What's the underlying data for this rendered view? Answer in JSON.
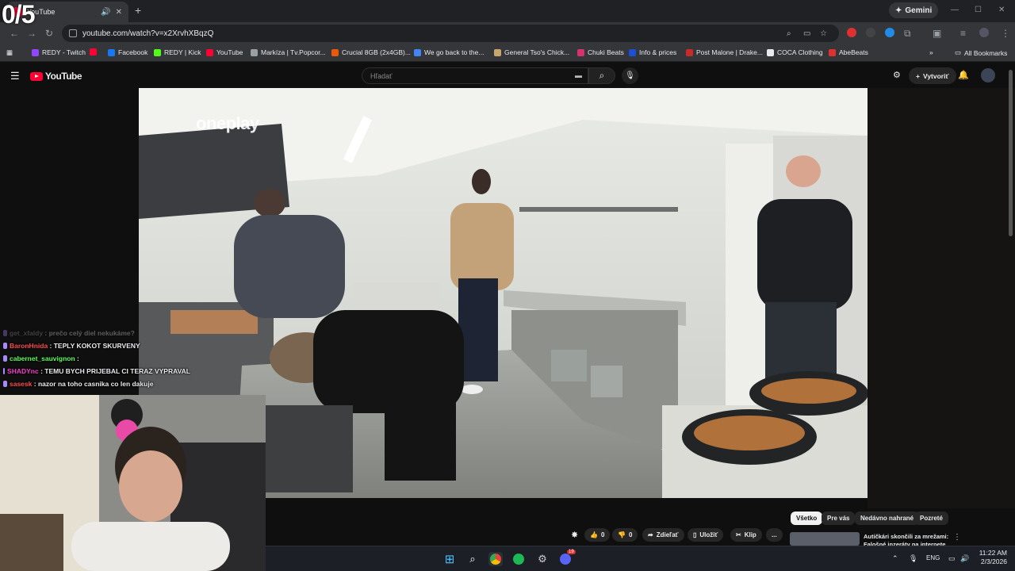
{
  "overlay_counter": "0/5",
  "browser": {
    "tab_title": "YouTube",
    "new_tab": "+",
    "gemini_label": "Gemini",
    "url": "youtube.com/watch?v=x2XrvhXBqzQ",
    "bookmarks": [
      {
        "label": "REDY - Twitch",
        "color": "#9146ff"
      },
      {
        "label": "",
        "color": "#ff0033"
      },
      {
        "label": "Facebook",
        "color": "#1877f2"
      },
      {
        "label": "REDY | Kick",
        "color": "#53fc18"
      },
      {
        "label": "YouTube",
        "color": "#ff0033"
      },
      {
        "label": "Markíza | Tv.Popcor...",
        "color": "#9aa0a6"
      },
      {
        "label": "Crucial 8GB (2x4GB)...",
        "color": "#e8590c"
      },
      {
        "label": "We go back to the...",
        "color": "#4285f4"
      },
      {
        "label": "General Tso's Chick...",
        "color": "#c9a66b"
      },
      {
        "label": "Chuki Beats",
        "color": "#d6336c"
      },
      {
        "label": "Info & prices",
        "color": "#1a4fd6"
      },
      {
        "label": "Post Malone | Drake...",
        "color": "#c92a2a"
      },
      {
        "label": "COCA Clothing",
        "color": "#e8eaed"
      },
      {
        "label": "AbeBeats",
        "color": "#e03131"
      }
    ],
    "bookmarks_more": "»",
    "all_bookmarks": "All Bookmarks"
  },
  "youtube": {
    "logo_text": "YouTube",
    "search_placeholder": "Hľadať",
    "create_label": "Vytvoriť",
    "video_watermark": "oneplay",
    "filter_chips": [
      "Všetko",
      "Pre vás",
      "Nedávno nahrané",
      "Pozreté"
    ],
    "actions": {
      "like_count": "0",
      "dislike_count": "0",
      "share": "Zdieľať",
      "save": "Uložiť",
      "clip": "Klip",
      "more": "..."
    },
    "recommendation_title": "Autičkári skončili za mrežami: Falošné inzeráty na internete"
  },
  "chat": [
    {
      "user": "get_xfaldy",
      "user_color": "#9b9b9b",
      "message": "prečo celý diel nekukáme?",
      "faded": true
    },
    {
      "user": "BaronHnida",
      "user_color": "#ff4d4d",
      "message": "TEPLY KOKOT SKURVENY"
    },
    {
      "user": "cabernet_sauvignon",
      "user_color": "#5bff5b",
      "message": ""
    },
    {
      "user": "SHADYnc",
      "user_color": "#ff3bd4",
      "message": "TEMU BYCH PRIJEBAL CI TERAZ VYPRAVAL"
    },
    {
      "user": "sasesk",
      "user_color": "#ff4d4d",
      "message": "nazor na toho casnika co len dakuje"
    }
  ],
  "taskbar": {
    "lang": "ENG",
    "time": "11:22 AM",
    "date": "2/3/2026",
    "discord_badge": "19"
  }
}
